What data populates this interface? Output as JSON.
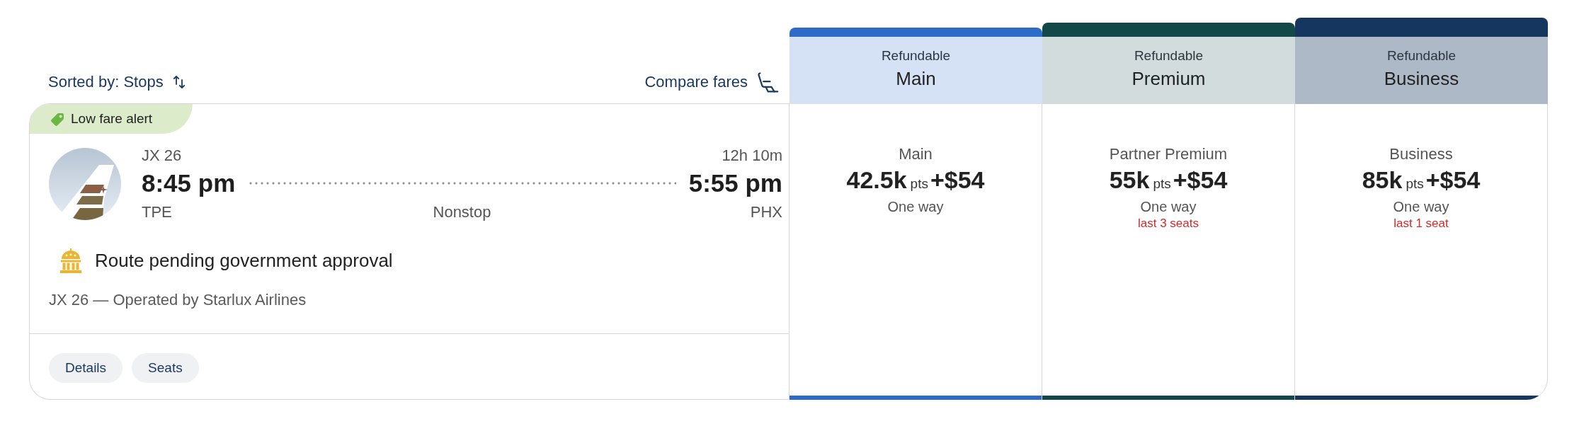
{
  "sort": {
    "label": "Sorted by: Stops"
  },
  "compare": {
    "label": "Compare fares"
  },
  "flight": {
    "badge": "Low fare alert",
    "flight_number": "JX 26",
    "duration": "12h 10m",
    "departure_time": "8:45 pm",
    "arrival_time": "5:55 pm",
    "origin": "TPE",
    "stops": "Nonstop",
    "destination": "PHX",
    "notice": "Route pending government approval",
    "operated_by": "JX 26 — Operated by Starlux Airlines",
    "buttons": [
      "Details",
      "Seats"
    ]
  },
  "fare_columns": [
    {
      "color": "#2d6bc9",
      "header": {
        "label": "Refundable",
        "cabin": "Main"
      },
      "fare": {
        "name": "Main",
        "points": "42.5k",
        "unit": "pts",
        "cash": "+$54",
        "trip": "One way"
      }
    },
    {
      "color": "#134848",
      "header": {
        "label": "Refundable",
        "cabin": "Premium"
      },
      "fare": {
        "name": "Partner Premium",
        "points": "55k",
        "unit": "pts",
        "cash": "+$54",
        "trip": "One way",
        "seats_left": "last 3 seats"
      }
    },
    {
      "color": "#15365e",
      "header": {
        "label": "Refundable",
        "cabin": "Business"
      },
      "fare": {
        "name": "Business",
        "points": "85k",
        "unit": "pts",
        "cash": "+$54",
        "trip": "One way",
        "seats_left": "last 1 seat"
      }
    }
  ]
}
